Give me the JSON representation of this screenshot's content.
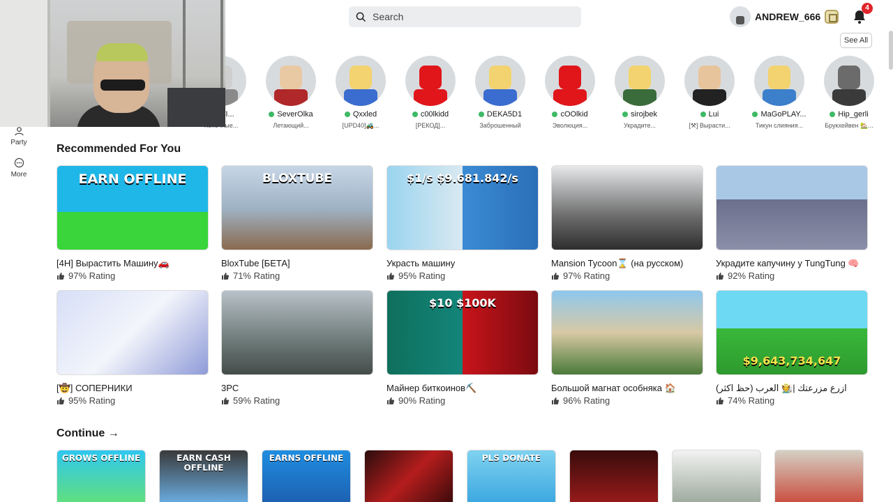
{
  "header": {
    "search_placeholder": "Search",
    "username": "ANDREW_666",
    "notification_count": "4",
    "see_all_label": "See All"
  },
  "leftnav": {
    "items": [
      {
        "label": "Party",
        "icon": "party-icon"
      },
      {
        "label": "More",
        "icon": "more-icon"
      }
    ]
  },
  "friends": [
    {
      "name": "SKWI...",
      "status": "Конечные...",
      "online": false,
      "skin": "#cfcfcf",
      "shirt": "#8a8a8a"
    },
    {
      "name": "SeverOlka",
      "status": "Летающий...",
      "online": true,
      "skin": "#e9c9a3",
      "shirt": "#b0282a"
    },
    {
      "name": "Qxxled",
      "status": "[UPD40]🚜...",
      "online": true,
      "skin": "#f3d36f",
      "shirt": "#3b6ccf"
    },
    {
      "name": "c00lkidd",
      "status": "[РЕКОД]...",
      "online": true,
      "skin": "#e0161a",
      "shirt": "#e0161a"
    },
    {
      "name": "DEKA5D1",
      "status": "Заброшенный",
      "online": true,
      "skin": "#f3d36f",
      "shirt": "#3b6ccf"
    },
    {
      "name": "cOOlkid",
      "status": "Эволюция...",
      "online": true,
      "skin": "#e0161a",
      "shirt": "#e0161a"
    },
    {
      "name": "sirojbek",
      "status": "Украдите...",
      "online": true,
      "skin": "#f3d36f",
      "shirt": "#3a6b3a"
    },
    {
      "name": "Lui",
      "status": "[⚒] Вырасти...",
      "online": true,
      "skin": "#e8c49c",
      "shirt": "#222222"
    },
    {
      "name": "MaGoPLAY...",
      "status": "Тикун слияния...",
      "online": true,
      "skin": "#f3d36f",
      "shirt": "#3c7fcb"
    },
    {
      "name": "Hip_gerli",
      "status": "Брукхейвен 🏡...",
      "online": true,
      "skin": "#6b6b6b",
      "shirt": "#3a3a3a"
    }
  ],
  "recommended": {
    "title": "Recommended For You",
    "cards": [
      {
        "title": "[4H] Вырастить Машину🚗",
        "rating": "97% Rating",
        "thumb_text": "EARN OFFLINE",
        "bg": "linear-gradient(180deg,#1fb7e8 0%,#1fb7e8 55%,#39d53a 55%,#39d53a 100%)"
      },
      {
        "title": "BloxTube [БЕТА]",
        "rating": "71% Rating",
        "thumb_text": "BLOXTUBE",
        "bg": "linear-gradient(180deg,#c7d6e6 0%,#9fb3c6 50%,#8a6a4e 100%)"
      },
      {
        "title": "Украсть машину",
        "rating": "95% Rating",
        "thumb_text": "$1/s   $9.681.842/s",
        "bg": "linear-gradient(90deg,#9ad4ef 0%,#d9e9f1 50%,#3b8bd4 50%,#2a6fb8 100%)"
      },
      {
        "title": "Mansion Tycoon⌛ (на русском)",
        "rating": "97% Rating",
        "thumb_text": "",
        "bg": "linear-gradient(180deg,#e6e8ea 0%,#6c6c6c 60%,#2e2e2e 100%)"
      },
      {
        "title": "Украдите капучину у TungTung 🧠",
        "rating": "92% Rating",
        "thumb_text": "",
        "bg": "linear-gradient(180deg,#a8c8e6 0%,#a8c8e6 40%,#6b6f8c 40%,#8b8fa8 100%)"
      },
      {
        "title": "[🤠] СОПЕРНИКИ",
        "rating": "95% Rating",
        "thumb_text": "",
        "bg": "linear-gradient(135deg,#d7dff7 0%,#f3f5fb 50%,#8f9bd8 100%)"
      },
      {
        "title": "3PC",
        "rating": "59% Rating",
        "thumb_text": "",
        "bg": "linear-gradient(180deg,#b9c2c8 0%,#6d7a78 60%,#444c4a 100%)"
      },
      {
        "title": "Майнер биткоинов⛏️",
        "rating": "90% Rating",
        "thumb_text": "$10     $100K",
        "bg": "linear-gradient(90deg,#0f6f5c 0%,#13857a 50%,#c8141a 50%,#7a0b10 100%)"
      },
      {
        "title": "Большой магнат особняка 🏠",
        "rating": "96% Rating",
        "thumb_text": "",
        "bg": "linear-gradient(180deg,#8ec7ee 0%,#d8c9a4 50%,#4a7a3a 100%)"
      },
      {
        "title": "ازرع مزرعتك |🧑‍🌾 العرب (حظ اكثر)",
        "rating": "74% Rating",
        "thumb_text": "$9,643,734,647",
        "bg": "linear-gradient(180deg,#6dd9f2 0%,#6dd9f2 45%,#39b83a 45%,#2e9a2f 100%)"
      }
    ]
  },
  "continue": {
    "title": "Continue →",
    "items": [
      {
        "label": "GROWS OFFLINE",
        "bg": "linear-gradient(180deg,#2fc7f0 0%,#62e07a 100%)"
      },
      {
        "label": "EARN CASH OFFLINE",
        "bg": "linear-gradient(180deg,#3a3a3a 0%,#6bb0e6 100%)"
      },
      {
        "label": "EARNS OFFLINE",
        "bg": "linear-gradient(180deg,#1f8de0 0%,#1e5fb0 100%)"
      },
      {
        "label": "",
        "bg": "linear-gradient(135deg,#2b0d0d 0%,#b51d1d 50%,#3a0a0a 100%)"
      },
      {
        "label": "PLS DONATE",
        "bg": "linear-gradient(180deg,#7fd2f0 0%,#39a6e0 100%)"
      },
      {
        "label": "",
        "bg": "linear-gradient(180deg,#3a0c0c 0%,#9a1b1b 100%)"
      },
      {
        "label": "",
        "bg": "linear-gradient(180deg,#f2f2f2 0%,#9aa89a 100%)"
      },
      {
        "label": "",
        "bg": "linear-gradient(180deg,#d5d0c4 0%,#c94a3a 100%)"
      }
    ]
  }
}
